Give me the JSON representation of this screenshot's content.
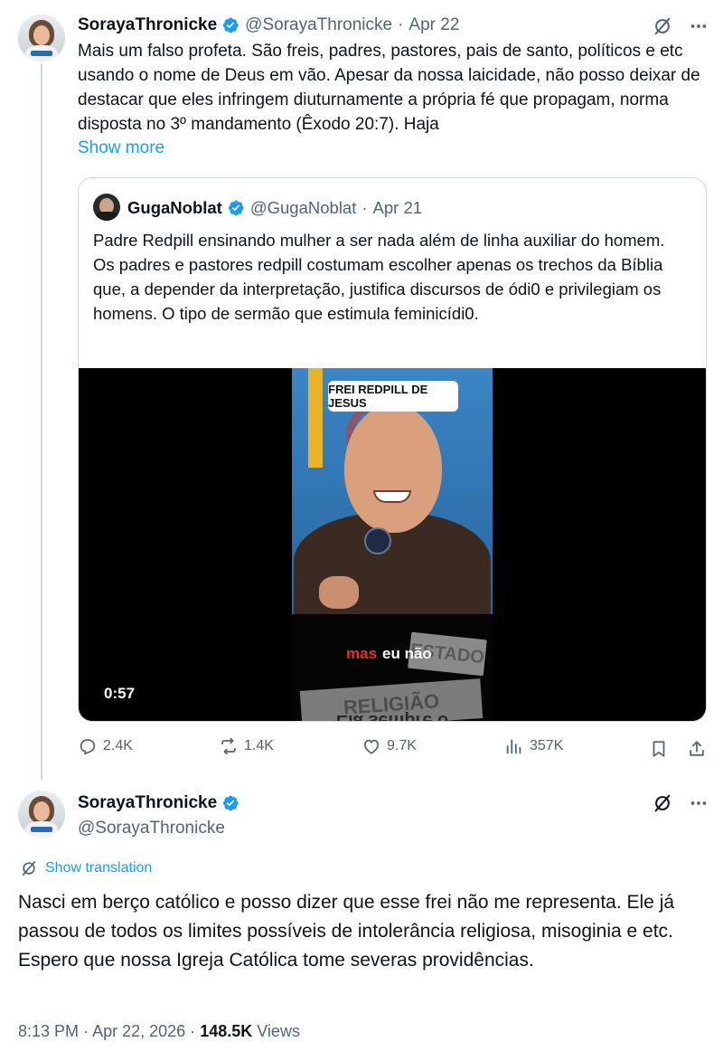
{
  "colors": {
    "accent": "#1d9bf0",
    "text": "#0f1419",
    "muted": "#536471",
    "border": "#cfd9de"
  },
  "reply_tweet": {
    "author_name": "SorayaThronicke",
    "handle": "@SorayaThronicke",
    "separator": "·",
    "date": "Apr 22",
    "text": "Mais um falso profeta. São freis, padres, pastores, pais de santo, políticos e etc usando o nome de Deus em vão. Apesar da nossa laicidade, não posso deixar de destacar que eles infringem diuturnamente a própria fé que propagam, norma disposta no  3º mandamento (Êxodo 20:7). Haja",
    "show_more": "Show more",
    "icons": [
      "grok-icon",
      "more-icon"
    ]
  },
  "quoted_tweet": {
    "author_name": "GugaNoblat",
    "handle": "@GugaNoblat",
    "separator": "·",
    "date": "Apr 21",
    "text": "Padre Redpill ensinando mulher a ser nada além de linha auxiliar do homem. Os padres e pastores redpill costumam escolher apenas os trechos da Bíblia que, a depender da interpretação, justifica discursos de ódi0 e privilegiam os homens. O tipo de sermão que estimula feminicídi0.",
    "video": {
      "overlay_title": "FREI REDPILL DE JESUS",
      "caption_highlight": "mas",
      "caption_rest": "eu não",
      "sign_top": "ESTADO",
      "sign_bottom": "RELIGIÃO",
      "mirrored_text": "Ela sempre o",
      "duration": "0:57"
    }
  },
  "actions": {
    "replies": "2.4K",
    "reposts": "1.4K",
    "likes": "9.7K",
    "views": "357K"
  },
  "main_tweet": {
    "author_name": "SorayaThronicke",
    "handle": "@SorayaThronicke",
    "show_translation": "Show translation",
    "text": "Nasci em berço católico e posso dizer que esse frei não me representa. Ele já passou de todos os limites possíveis de intolerância religiosa, misoginia e etc. Espero que nossa Igreja Católica tome severas providências.",
    "time": "8:13 PM",
    "separator": "·",
    "date": "Apr 22, 2026",
    "views_count": "148.5K",
    "views_label": "Views"
  }
}
